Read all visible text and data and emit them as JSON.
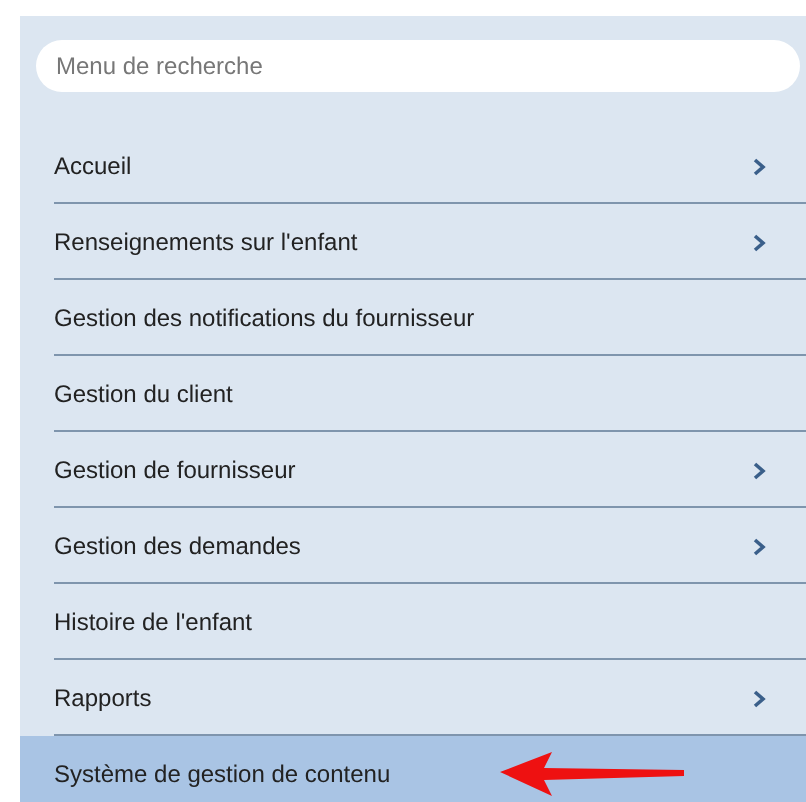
{
  "search": {
    "placeholder": "Menu de recherche"
  },
  "menu": [
    {
      "label": "Accueil",
      "has_submenu": true,
      "selected": false
    },
    {
      "label": "Renseignements sur l'enfant",
      "has_submenu": true,
      "selected": false
    },
    {
      "label": "Gestion des notifications du fournisseur",
      "has_submenu": false,
      "selected": false
    },
    {
      "label": "Gestion du client",
      "has_submenu": false,
      "selected": false
    },
    {
      "label": "Gestion de fournisseur",
      "has_submenu": true,
      "selected": false
    },
    {
      "label": "Gestion des demandes",
      "has_submenu": true,
      "selected": false
    },
    {
      "label": "Histoire de l'enfant",
      "has_submenu": false,
      "selected": false
    },
    {
      "label": "Rapports",
      "has_submenu": true,
      "selected": false
    },
    {
      "label": "Système de gestion de contenu",
      "has_submenu": false,
      "selected": true
    }
  ]
}
